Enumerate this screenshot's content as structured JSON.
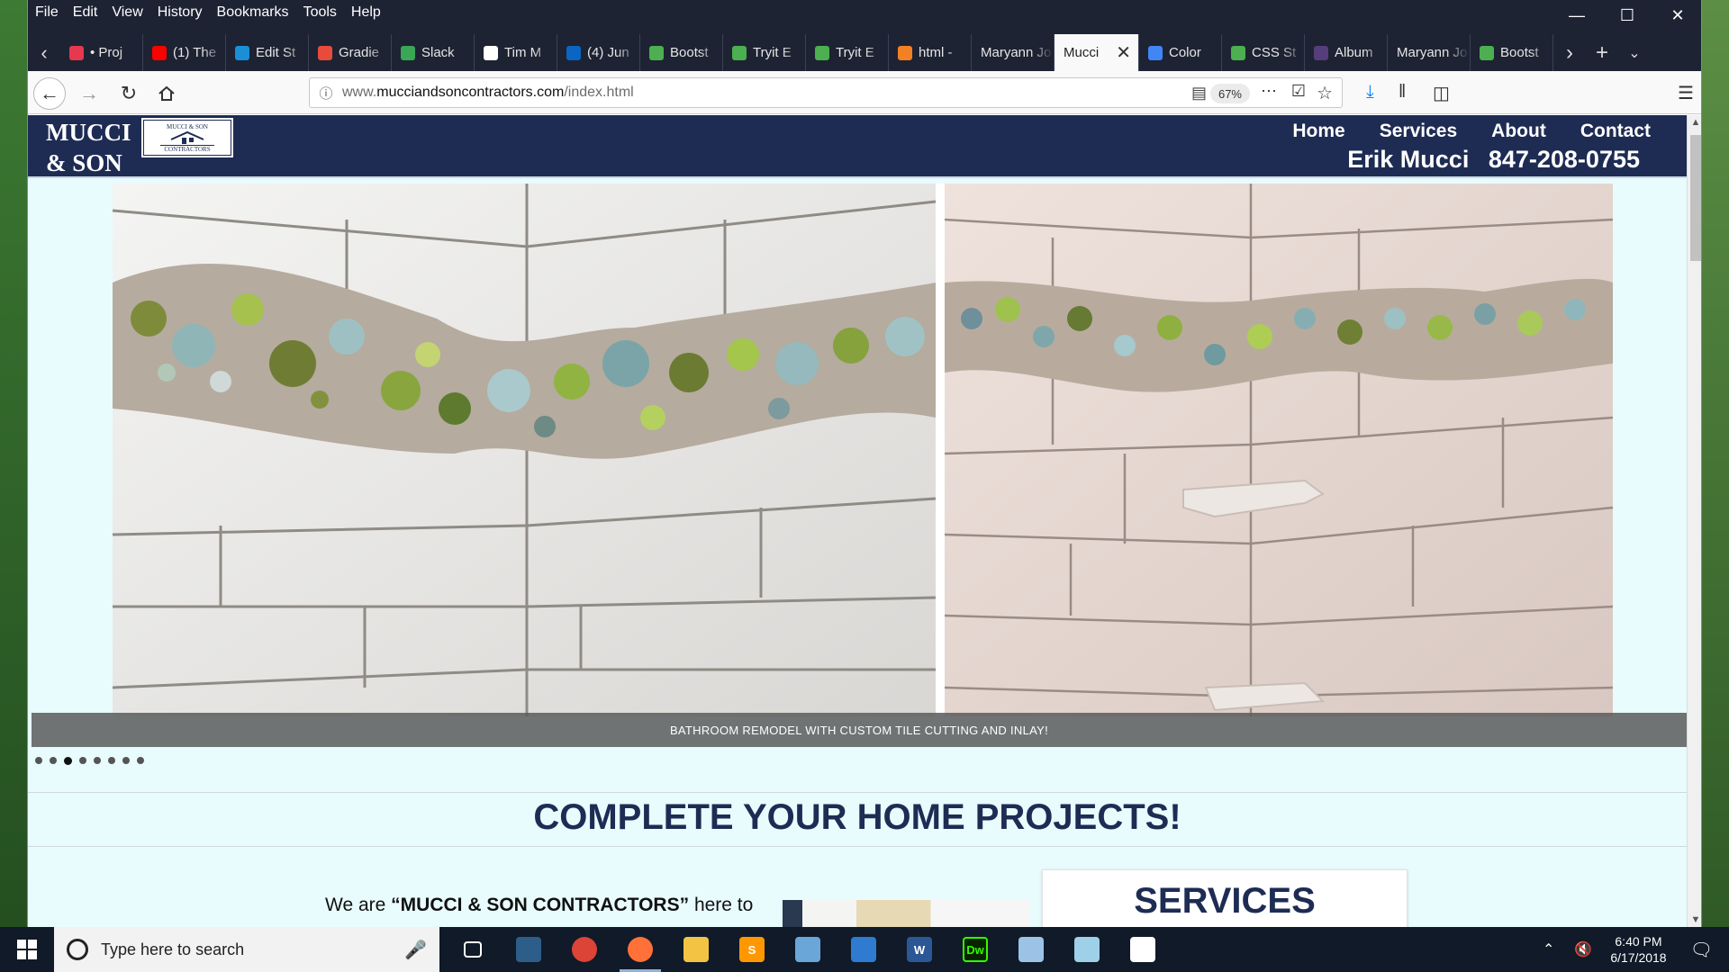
{
  "menubar": {
    "items": [
      "File",
      "Edit",
      "View",
      "History",
      "Bookmarks",
      "Tools",
      "Help"
    ]
  },
  "tabs": [
    {
      "label": "• Proj",
      "icon": "asana-icon",
      "color": "#e8384f"
    },
    {
      "label": "(1) The",
      "icon": "youtube-icon",
      "color": "#ff0000"
    },
    {
      "label": "Edit St",
      "icon": "edit-icon",
      "color": "#1a8fd6"
    },
    {
      "label": "Gradie",
      "icon": "gradient-icon",
      "color": "#e84b3c"
    },
    {
      "label": "Slack",
      "icon": "slack-icon",
      "color": "#3aa757"
    },
    {
      "label": "Tim M",
      "icon": "github-icon",
      "color": "#ffffff"
    },
    {
      "label": "(4) Jun",
      "icon": "linkedin-icon",
      "color": "#0a66c2"
    },
    {
      "label": "Bootst",
      "icon": "w3-icon",
      "color": "#4caf50"
    },
    {
      "label": "Tryit E",
      "icon": "w3-icon",
      "color": "#4caf50"
    },
    {
      "label": "Tryit E",
      "icon": "w3-icon",
      "color": "#4caf50"
    },
    {
      "label": "html -",
      "icon": "stackoverflow-icon",
      "color": "#f48024"
    },
    {
      "label": "Maryann Jo",
      "icon": "none",
      "color": ""
    },
    {
      "label": "Mucci",
      "icon": "none",
      "color": "",
      "active": true
    },
    {
      "label": "Color",
      "icon": "color-icon",
      "color": "#4285f4"
    },
    {
      "label": "CSS St",
      "icon": "w3-icon",
      "color": "#4caf50"
    },
    {
      "label": "Album",
      "icon": "bootstrap-icon",
      "color": "#563d7c"
    },
    {
      "label": "Maryann Jo",
      "icon": "none",
      "color": ""
    },
    {
      "label": "Bootst",
      "icon": "w3-icon",
      "color": "#4caf50"
    }
  ],
  "navbar": {
    "url_prefix": "www.",
    "url_domain": "mucciandsoncontractors.com",
    "url_path": "/index.html",
    "zoom": "67%"
  },
  "site": {
    "brand_line1": "MUCCI",
    "brand_line2": "& SON",
    "logo_top": "MUCCI & SON",
    "logo_bottom": "CONTRACTORS",
    "nav": [
      "Home",
      "Services",
      "About",
      "Contact"
    ],
    "contact_name": "Erik Mucci",
    "contact_phone": "847-208-0755",
    "slide_caption": "BATHROOM REMODEL WITH CUSTOM TILE CUTTING AND INLAY!",
    "slide_count": 8,
    "active_slide": 3,
    "headline": "COMPLETE YOUR HOME PROJECTS!",
    "intro_pre": "We are ",
    "intro_bold": "“MUCCI & SON CONTRACTORS”",
    "intro_post": " here to",
    "services_title": "SERVICES",
    "colors": {
      "navy": "#1e2c54",
      "page_bg": "#e8fbfd"
    }
  },
  "taskbar": {
    "search_placeholder": "Type here to search",
    "time": "6:40 PM",
    "date": "6/17/2018",
    "apps": [
      {
        "name": "task-view-icon",
        "label": "",
        "color": "transparent"
      },
      {
        "name": "mysql-workbench-icon",
        "label": "",
        "color": "#2d5e8a"
      },
      {
        "name": "chrome-icon",
        "label": "",
        "color": "#db4437"
      },
      {
        "name": "firefox-icon",
        "label": "",
        "color": "#ff7139",
        "open": true
      },
      {
        "name": "file-explorer-icon",
        "label": "",
        "color": "#f3c443"
      },
      {
        "name": "sublime-text-icon",
        "label": "S",
        "color": "#ff9800"
      },
      {
        "name": "paint-icon",
        "label": "",
        "color": "#6aa7d8"
      },
      {
        "name": "git-icon",
        "label": "",
        "color": "#2e7bcf"
      },
      {
        "name": "word-icon",
        "label": "W",
        "color": "#2b5797"
      },
      {
        "name": "dreamweaver-icon",
        "label": "Dw",
        "color": "#35fa00"
      },
      {
        "name": "paint-palette-icon",
        "label": "",
        "color": "#9cc3e6"
      },
      {
        "name": "notepad-icon",
        "label": "",
        "color": "#9ed0e8"
      },
      {
        "name": "photos-icon",
        "label": "",
        "color": "#ffffff"
      }
    ]
  }
}
